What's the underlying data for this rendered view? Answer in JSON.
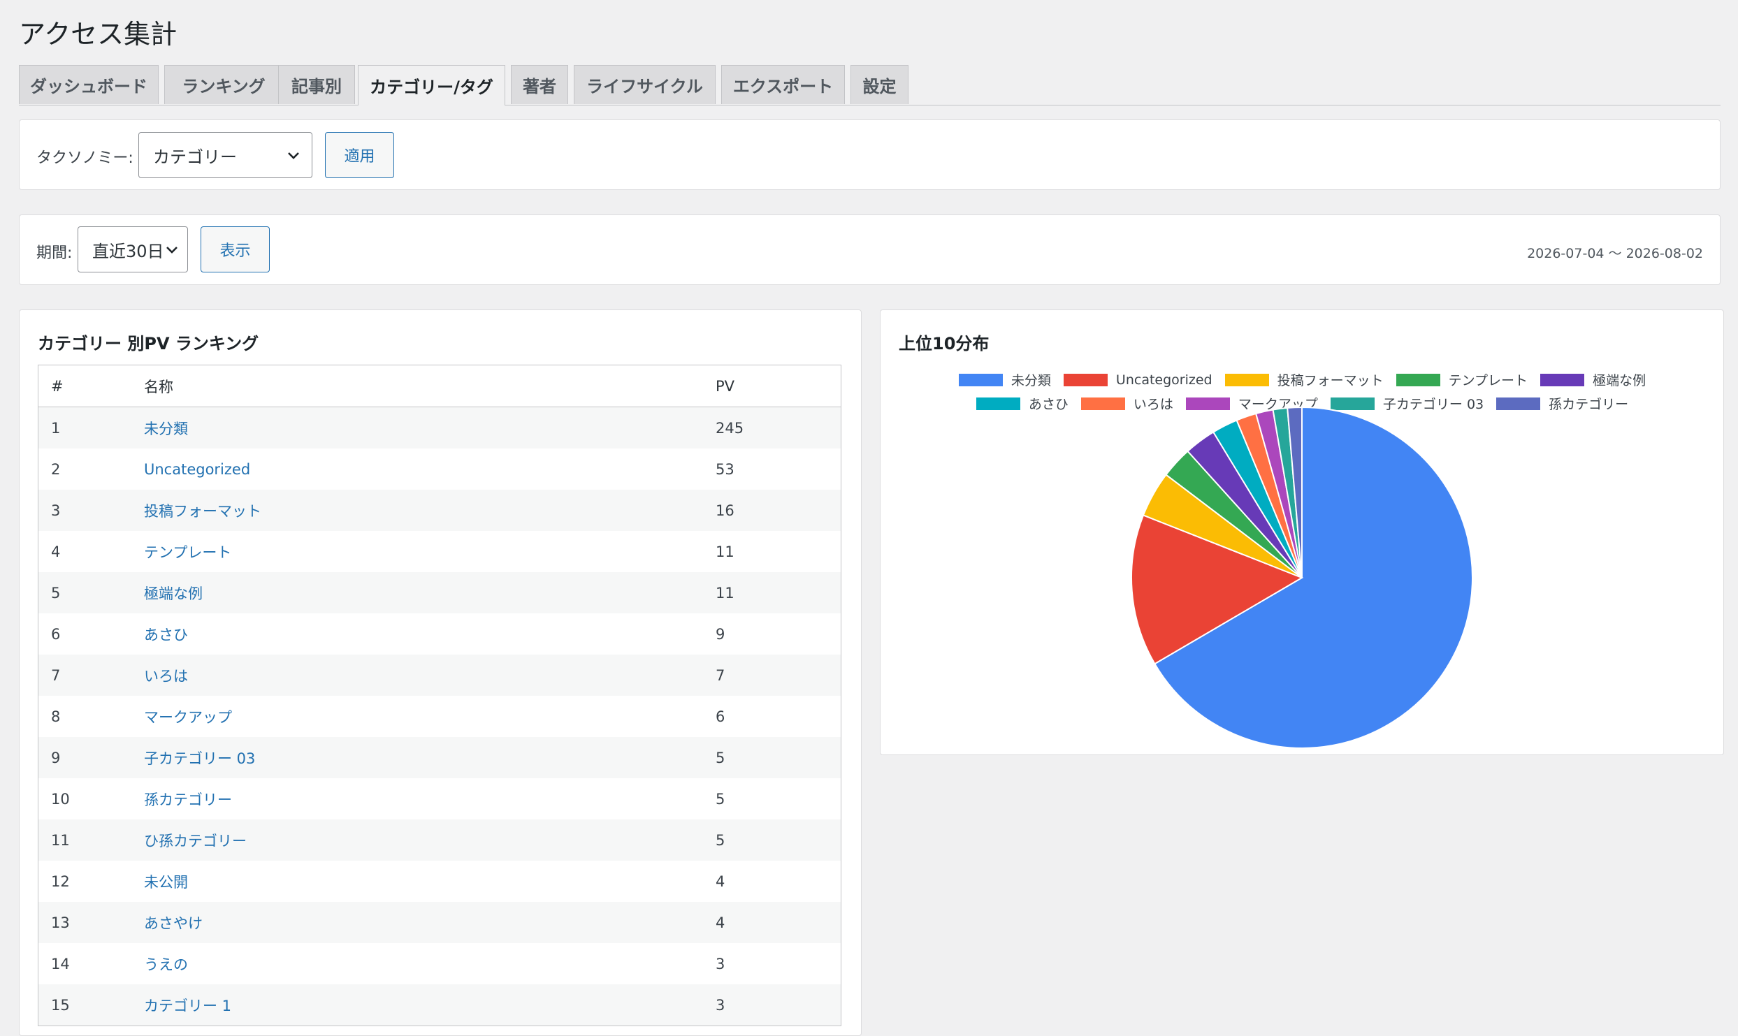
{
  "page": {
    "title": "アクセス集計"
  },
  "tabs": [
    {
      "label": "ダッシュボード",
      "active": false
    },
    {
      "label": "ランキング",
      "active": false
    },
    {
      "label": "記事別",
      "active": false
    },
    {
      "label": "カテゴリー/タグ",
      "active": true
    },
    {
      "label": "著者",
      "active": false
    },
    {
      "label": "ライフサイクル",
      "active": false
    },
    {
      "label": "エクスポート",
      "active": false
    },
    {
      "label": "設定",
      "active": false
    }
  ],
  "taxonomy_filter": {
    "label": "タクソノミー:",
    "selected": "カテゴリー",
    "apply_label": "適用"
  },
  "period_filter": {
    "label": "期間:",
    "selected": "直近30日",
    "show_label": "表示",
    "date_range": "2026-07-04 〜 2026-08-02"
  },
  "ranking": {
    "title": "カテゴリー 別PV ランキング",
    "columns": [
      "#",
      "名称",
      "PV"
    ],
    "rows": [
      {
        "rank": "1",
        "name": "未分類",
        "pv": "245"
      },
      {
        "rank": "2",
        "name": "Uncategorized",
        "pv": "53"
      },
      {
        "rank": "3",
        "name": "投稿フォーマット",
        "pv": "16"
      },
      {
        "rank": "4",
        "name": "テンプレート",
        "pv": "11"
      },
      {
        "rank": "5",
        "name": "極端な例",
        "pv": "11"
      },
      {
        "rank": "6",
        "name": "あさひ",
        "pv": "9"
      },
      {
        "rank": "7",
        "name": "いろは",
        "pv": "7"
      },
      {
        "rank": "8",
        "name": "マークアップ",
        "pv": "6"
      },
      {
        "rank": "9",
        "name": "子カテゴリー 03",
        "pv": "5"
      },
      {
        "rank": "10",
        "name": "孫カテゴリー",
        "pv": "5"
      },
      {
        "rank": "11",
        "name": "ひ孫カテゴリー",
        "pv": "5"
      },
      {
        "rank": "12",
        "name": "未公開",
        "pv": "4"
      },
      {
        "rank": "13",
        "name": "あさやけ",
        "pv": "4"
      },
      {
        "rank": "14",
        "name": "うえの",
        "pv": "3"
      },
      {
        "rank": "15",
        "name": "カテゴリー 1",
        "pv": "3"
      }
    ]
  },
  "distribution": {
    "title": "上位10分布"
  },
  "chart_data": {
    "type": "pie",
    "categories": [
      "未分類",
      "Uncategorized",
      "投稿フォーマット",
      "テンプレート",
      "極端な例",
      "あさひ",
      "いろは",
      "マークアップ",
      "子カテゴリー 03",
      "孫カテゴリー"
    ],
    "values": [
      245,
      53,
      16,
      11,
      11,
      9,
      7,
      6,
      5,
      5
    ],
    "colors": [
      "#4285f4",
      "#ea4335",
      "#fbbc04",
      "#34a853",
      "#673ab7",
      "#00acc1",
      "#ff7043",
      "#ab47bc",
      "#26a69a",
      "#5c6bc0"
    ],
    "legend_position": "top"
  }
}
